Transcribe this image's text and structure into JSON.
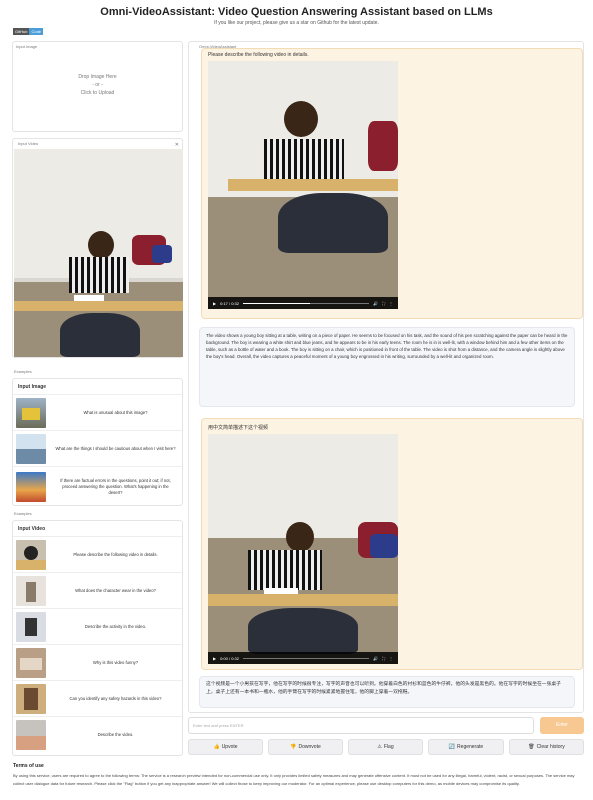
{
  "header": {
    "title": "Omni-VideoAssistant: Video Question Answering Assistant based on LLMs",
    "subtitle": "If you like our project, please give us a star on Github for the latest update.",
    "badge_left": "GitHub",
    "badge_right": "Code"
  },
  "input_image": {
    "label": "Input Image",
    "drop_line1": "Drop Image Here",
    "drop_or": "- or -",
    "drop_line2": "Click to Upload"
  },
  "input_video": {
    "label": "Input Video"
  },
  "image_examples": {
    "section_label": "Examples",
    "header": "Input Image",
    "items": [
      {
        "text": "What is unusual about this image?"
      },
      {
        "text": "What are the things I should be cautious about when I visit here?"
      },
      {
        "text": "If there are factual errors in the questions, point it out; if not, proceed answering the question. What's happening in the desert?"
      }
    ]
  },
  "video_examples": {
    "section_label": "Examples",
    "header": "Input Video",
    "items": [
      {
        "text": "Please describe the following video in details."
      },
      {
        "text": "What does the character wear in the video?"
      },
      {
        "text": "Describe the activity in the video."
      },
      {
        "text": "Why is this video funny?"
      },
      {
        "text": "Can you identify any safety hazards in this video?"
      },
      {
        "text": "Describe the video."
      }
    ]
  },
  "chat": {
    "label": "Omni-VideoAssistant",
    "messages": [
      {
        "role": "user",
        "text": "Please describe the following video in details.",
        "video_time": "0:17 / 0:32"
      },
      {
        "role": "bot",
        "text": "The video shows a young boy sitting at a table, writing on a piece of paper. He seems to be focused on his task, and the sound of his pen scratching against the paper can be heard in the background. The boy is wearing a white shirt and blue jeans, and he appears to be in his early teens. The room he is in is well-lit, with a window behind him and a few other items on the table, such as a bottle of water and a book. The boy is sitting on a chair, which is positioned in front of the table. The video is shot from a distance, and the camera angle is slightly above the boy's head. Overall, the video captures a peaceful moment of a young boy engrossed in his writing, surrounded by a well-lit and organized room."
      },
      {
        "role": "user",
        "text": "用中文简单描述下这个视频",
        "video_time": "0:00 / 0:32"
      },
      {
        "role": "bot",
        "text": "这个视频是一个小男孩在写字，他在写字的时候很专注，写字的声音也可以听到。他穿着白色的衬衫和蓝色的牛仔裤，他的头发是黑色的。他在写字的时候坐在一张桌子上，桌子上还有一本书和一瓶水，他的手臂在写字的时候紧紧地握住笔，他的脚上穿着一双拖鞋。"
      }
    ]
  },
  "composer": {
    "placeholder": "Enter text and press ENTER",
    "enter_label": "Enter"
  },
  "actions": [
    {
      "label": "Upvote",
      "icon": "👍"
    },
    {
      "label": "Downvote",
      "icon": "👎"
    },
    {
      "label": "Flag",
      "icon": "⚠"
    },
    {
      "label": "Regenerate",
      "icon": "🔄"
    },
    {
      "label": "Clear history",
      "icon": "🗑"
    }
  ],
  "terms": {
    "title": "Terms of use",
    "text": "By using this service, users are required to agree to the following terms: The service is a research preview intended for non-commercial use only. It only provides limited safety measures and may generate offensive content. It must not be used for any illegal, harmful, violent, racist, or sexual purposes. The service may collect user dialogue data for future research. Please click the \"Flag\" button if you get any inappropriate answer! We will collect those to keep improving our moderator. For an optimal experience, please use desktop computers for this demo, as mobile devices may compromise its quality."
  },
  "colors": {
    "accent": "#f7c892",
    "user_bubble": "#fdf3e3",
    "bot_bubble": "#f4f6fa"
  }
}
